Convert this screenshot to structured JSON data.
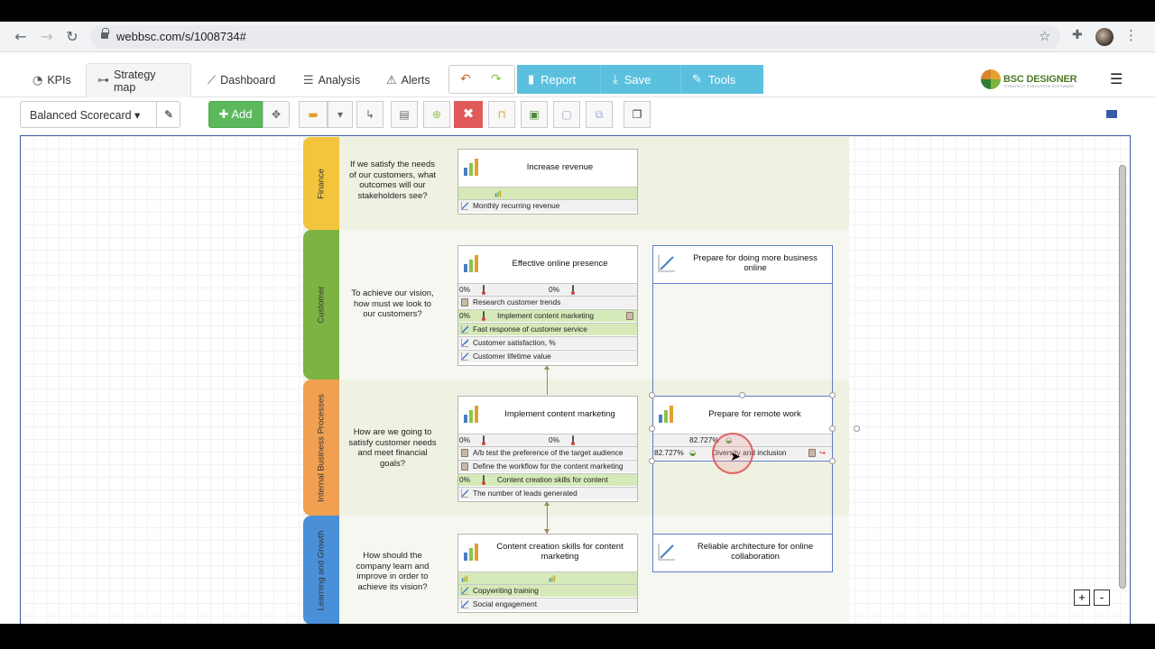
{
  "browser": {
    "url": "webbsc.com/s/1008734#"
  },
  "tabs": [
    {
      "label": "KPIs",
      "icon": "speedometer-icon"
    },
    {
      "label": "Strategy map",
      "icon": "sitemap-icon"
    },
    {
      "label": "Dashboard",
      "icon": "line-chart-icon"
    },
    {
      "label": "Analysis",
      "icon": "list-icon"
    },
    {
      "label": "Alerts",
      "icon": "warning-icon"
    }
  ],
  "actions": {
    "report": "Report",
    "save": "Save",
    "tools": "Tools"
  },
  "brand": {
    "name": "BSC DESIGNER",
    "tagline": "STRATEGY EXECUTION SOFTWARE"
  },
  "toolbar": {
    "scorecard": "Balanced Scorecard",
    "add": "Add"
  },
  "zoom": {
    "in": "+",
    "out": "-"
  },
  "perspectives": [
    {
      "name": "Finance",
      "color": "#f2c53d",
      "question": "If we satisfy the needs of our customers, what outcomes will our stakeholders see?"
    },
    {
      "name": "Customer",
      "color": "#7cb342",
      "question": "To achieve our vision, how must we look to our customers?"
    },
    {
      "name": "Internal Business Processes",
      "color": "#f0a050",
      "question": "How are we going to satisfy customer needs and meet financial goals?"
    },
    {
      "name": "Learning and Growth",
      "color": "#4a90d9",
      "question": "How should the company learn and improve in order to achieve its vision?"
    }
  ],
  "goals": {
    "increase_revenue": {
      "title": "Increase revenue",
      "rows": [
        "Monthly recurring revenue"
      ]
    },
    "online_presence": {
      "title": "Effective online presence",
      "pct_a": "0%",
      "pct_b": "0%",
      "rows": [
        "Research customer trends",
        "0%",
        "Implement content marketing",
        "Fast response of customer service",
        "Customer satisfaction, %",
        "Customer lifetime value"
      ]
    },
    "more_business_online": {
      "title": "Prepare for doing more business online"
    },
    "content_marketing": {
      "title": "Implement content marketing",
      "pct_a": "0%",
      "pct_b": "0%",
      "rows": [
        "A/b test the preference of the target audience",
        "Define the workflow for the content marketing",
        "0%",
        "Content creation skills for content",
        "The number of leads generated"
      ]
    },
    "remote_work": {
      "title": "Prepare for remote work",
      "pct_a": "82.727%",
      "row_pct": "82.727%",
      "row_label": "Diversity and inclusion"
    },
    "content_skills": {
      "title": "Content creation skills for content marketing",
      "rows": [
        "Copywriting training",
        "Social engagement"
      ]
    },
    "reliable_arch": {
      "title": "Reliable architecture for online collaboration"
    }
  }
}
